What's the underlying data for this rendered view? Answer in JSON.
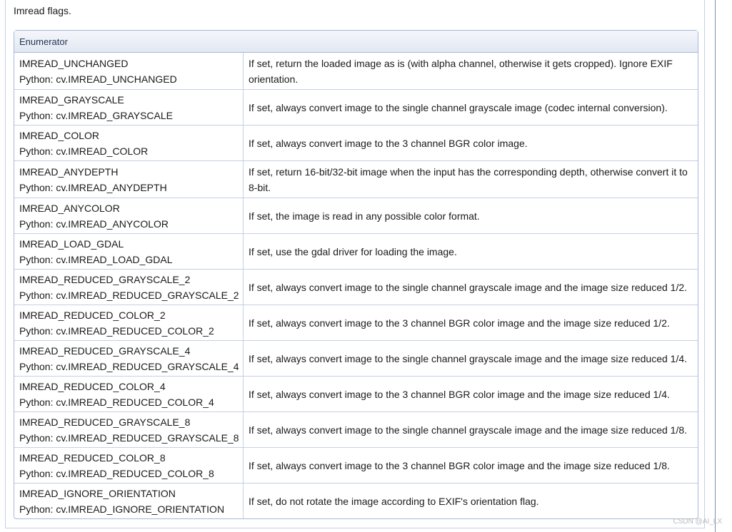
{
  "intro": "Imread flags.",
  "table": {
    "header": "Enumerator",
    "rows": [
      {
        "name": "IMREAD_UNCHANGED",
        "python": "Python: cv.IMREAD_UNCHANGED",
        "desc": "If set, return the loaded image as is (with alpha channel, otherwise it gets cropped). Ignore EXIF orientation."
      },
      {
        "name": "IMREAD_GRAYSCALE",
        "python": "Python: cv.IMREAD_GRAYSCALE",
        "desc": "If set, always convert image to the single channel grayscale image (codec internal conversion)."
      },
      {
        "name": "IMREAD_COLOR",
        "python": "Python: cv.IMREAD_COLOR",
        "desc": "If set, always convert image to the 3 channel BGR color image."
      },
      {
        "name": "IMREAD_ANYDEPTH",
        "python": "Python: cv.IMREAD_ANYDEPTH",
        "desc": "If set, return 16-bit/32-bit image when the input has the corresponding depth, otherwise convert it to 8-bit."
      },
      {
        "name": "IMREAD_ANYCOLOR",
        "python": "Python: cv.IMREAD_ANYCOLOR",
        "desc": "If set, the image is read in any possible color format."
      },
      {
        "name": "IMREAD_LOAD_GDAL",
        "python": "Python: cv.IMREAD_LOAD_GDAL",
        "desc": "If set, use the gdal driver for loading the image."
      },
      {
        "name": "IMREAD_REDUCED_GRAYSCALE_2",
        "python": "Python: cv.IMREAD_REDUCED_GRAYSCALE_2",
        "desc": "If set, always convert image to the single channel grayscale image and the image size reduced 1/2."
      },
      {
        "name": "IMREAD_REDUCED_COLOR_2",
        "python": "Python: cv.IMREAD_REDUCED_COLOR_2",
        "desc": "If set, always convert image to the 3 channel BGR color image and the image size reduced 1/2."
      },
      {
        "name": "IMREAD_REDUCED_GRAYSCALE_4",
        "python": "Python: cv.IMREAD_REDUCED_GRAYSCALE_4",
        "desc": "If set, always convert image to the single channel grayscale image and the image size reduced 1/4."
      },
      {
        "name": "IMREAD_REDUCED_COLOR_4",
        "python": "Python: cv.IMREAD_REDUCED_COLOR_4",
        "desc": "If set, always convert image to the 3 channel BGR color image and the image size reduced 1/4."
      },
      {
        "name": "IMREAD_REDUCED_GRAYSCALE_8",
        "python": "Python: cv.IMREAD_REDUCED_GRAYSCALE_8",
        "desc": "If set, always convert image to the single channel grayscale image and the image size reduced 1/8."
      },
      {
        "name": "IMREAD_REDUCED_COLOR_8",
        "python": "Python: cv.IMREAD_REDUCED_COLOR_8",
        "desc": "If set, always convert image to the 3 channel BGR color image and the image size reduced 1/8."
      },
      {
        "name": "IMREAD_IGNORE_ORIENTATION",
        "python": "Python: cv.IMREAD_IGNORE_ORIENTATION",
        "desc": "If set, do not rotate the image according to EXIF's orientation flag."
      }
    ]
  },
  "watermark": "CSDN @AI_LX",
  "colors": {
    "border": "#a8b8d9",
    "header_text": "#253555"
  }
}
